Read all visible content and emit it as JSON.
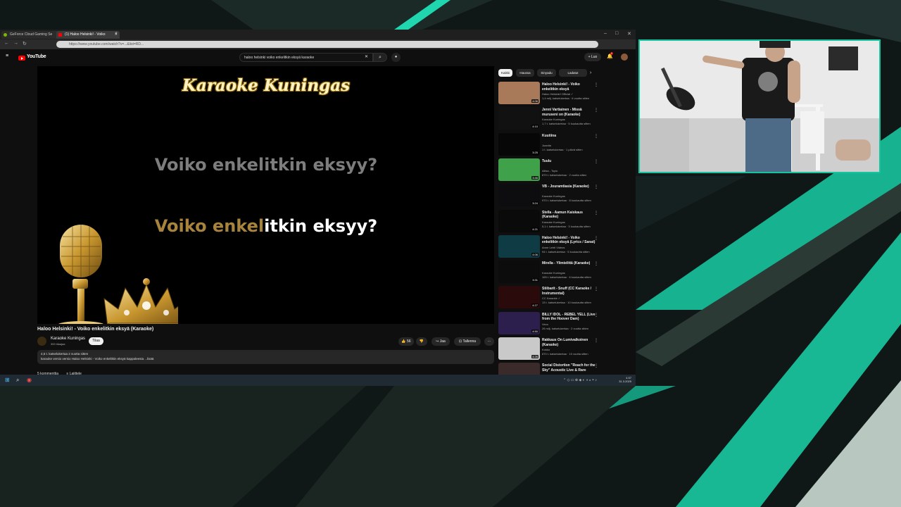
{
  "browser": {
    "tabs": [
      {
        "label": "GeForce Cloud Gaming Se"
      },
      {
        "label": "(1) Haloo Helsinki! - Voiko"
      }
    ],
    "url": "https://www.youtube.com/watch?v=...&list=RD...",
    "win_minimize": "–",
    "win_maximize": "□",
    "win_close": "✕"
  },
  "youtube": {
    "logo_text": "YouTube",
    "search_value": "haloo helsinki voiko enkelitkin eksyä karaoke",
    "create_label": "Luo",
    "notification_count": "9"
  },
  "video": {
    "overlay_title": "Karaoke Kuningas",
    "lyric_upcoming": "Voiko enkelitkin eksyy?",
    "lyric_sung_part": "Voiko enkel",
    "lyric_unsung_part": "itkin eksyy?",
    "colors": {
      "sung": "#a7833c",
      "upcoming": "#7d7d7d",
      "unsung": "#ffffff"
    }
  },
  "meta": {
    "title": "Haloo Helsinki! - Voiko enkelitkin eksyä (Karaoke)",
    "channel": "Karaoke Kuningas",
    "subscribers": "300 tilaajaa",
    "subscribe_label": "Tilaa",
    "likes": "56",
    "share_label": "Jaa",
    "save_label": "Tallenna",
    "more_label": "···",
    "desc_line1": "4,5 t. katselukertaa  2 vuotta sitten",
    "desc_line2": "karaoke versio versio Haloo Helsinki - Voiko enkelitkin eksyä kappaleesta  ...lisää",
    "comments_label": "5 kommenttia",
    "sort_label": "Lajittele"
  },
  "sidebar": {
    "chips": [
      "Kaikki",
      "Haussa",
      "Sinyadu",
      "Ladatut"
    ],
    "recs": [
      {
        "title": "Haloo Helsinki! - Voiko enkelitkin eksyä",
        "channel": "Haloo Helsinki! Official ✓",
        "meta": "1,4 milj. katselukertaa · 6 vuotta sitten",
        "duration": "4:06",
        "thumb": "#a87a5a"
      },
      {
        "title": "Jenni Vartiainen - Missä muruseni on (Karaoke)",
        "channel": "Karaoke Kuningas",
        "meta": "1,7 t. katselukertaa · 5 kuukautta sitten",
        "duration": "4:10",
        "thumb": "#111"
      },
      {
        "title": "Kuutiina",
        "channel": "Juanita",
        "meta": "1 t. katselukertaa · 1 päivä sitten",
        "duration": "3:25",
        "thumb": "#070707"
      },
      {
        "title": "Tuulu",
        "channel": "Aliisa - Topic",
        "meta": "870 t. katselukertaa · 2 vuotta sitten",
        "duration": "3:46",
        "thumb": "#3fa24a"
      },
      {
        "title": "VB - Jouramtiasia (Karaoke)",
        "channel": "Karaoke Kuningas",
        "meta": "970 t. katselukertaa · 8 kuukautta sitten",
        "duration": "3:24",
        "thumb": "#0d0d10"
      },
      {
        "title": "Stella - Aamun Kaiskaus (Karaoke)",
        "channel": "Karaoke Kuningas",
        "meta": "5,1 t. katselukertaa · 3 kuukautta sitten",
        "duration": "4:21",
        "thumb": "#0a0a0a"
      },
      {
        "title": "Haloo Helsinki! - Voiko enkelitkin eksyä (Lyrics / Sanat)",
        "channel": "Anne Lehti Videos",
        "meta": "94 t. katselukertaa · 5 kuukautta sitten",
        "duration": "4:06",
        "thumb": "#0f3b45"
      },
      {
        "title": "Mirella - Ylimielittä (Karaoke)",
        "channel": "Karaoke Kuningas",
        "meta": "165 t. katselukertaa · 6 kuukautta sitten",
        "duration": "3:31",
        "thumb": "#0c0c0c"
      },
      {
        "title": "Stiibarit - Snuff (CC Karaoke / Instrumental)",
        "channel": "CC Karaoke ✓",
        "meta": "13 t. katselukertaa · 10 kuukautta sitten",
        "duration": "4:27",
        "thumb": "#2a0a0a"
      },
      {
        "title": "BILLY IDOL - REBEL YELL (Live from the Hoover Dam)",
        "channel": "Vevo",
        "meta": "26 milj. katselukertaa · 2 vuotta sitten",
        "duration": "4:50",
        "thumb": "#2d1f4d"
      },
      {
        "title": "Rakkaus On Lumivalkoinen (Karaoke)",
        "channel": "Kokko",
        "meta": "870 t. katselukertaa · 10 vuotta sitten",
        "duration": "4:26",
        "thumb": "#c9c9c9"
      },
      {
        "title": "Social Distortion \"Reach for the Sky\" Acoustic Live & Rare",
        "channel": "",
        "meta": "",
        "duration": "",
        "thumb": "#3a2a2a"
      }
    ]
  },
  "taskbar": {
    "time": "4.57",
    "date": "31.3.2025"
  }
}
